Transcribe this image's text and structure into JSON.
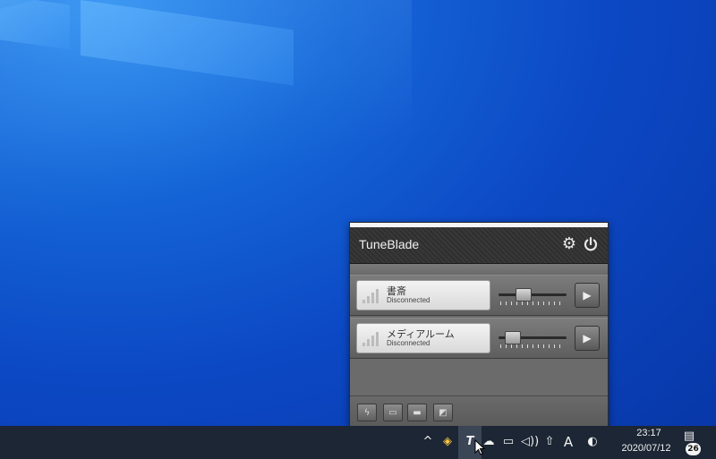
{
  "tuneblade": {
    "title": "TuneBlade",
    "devices": [
      {
        "name": "書斎",
        "status": "Disconnected",
        "volume": 0.35
      },
      {
        "name": "メディアルーム",
        "status": "Disconnected",
        "volume": 0.2
      }
    ],
    "icons": {
      "settings": "gear-icon",
      "power": "power-icon",
      "play": "play-icon",
      "footer": [
        "lightning-icon",
        "battery-icon",
        "display-icon",
        "chart-icon"
      ]
    }
  },
  "taskbar": {
    "time": "23:17",
    "date": "2020/07/12",
    "ime": "A",
    "notification_count": "26"
  }
}
